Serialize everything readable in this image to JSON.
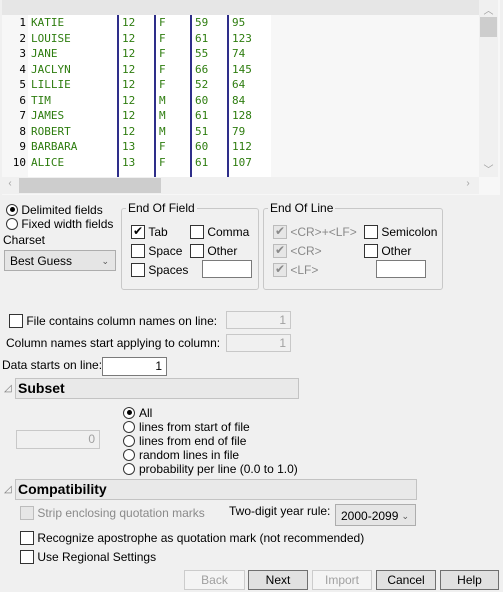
{
  "preview": {
    "row_numbers": [
      "1",
      "2",
      "3",
      "4",
      "5",
      "6",
      "7",
      "8",
      "9",
      "10"
    ],
    "rows": [
      [
        "KATIE",
        "12",
        "F",
        "59",
        "95"
      ],
      [
        "LOUISE",
        "12",
        "F",
        "61",
        "123"
      ],
      [
        "JANE",
        "12",
        "F",
        "55",
        "74"
      ],
      [
        "JACLYN",
        "12",
        "F",
        "66",
        "145"
      ],
      [
        "LILLIE",
        "12",
        "F",
        "52",
        "64"
      ],
      [
        "TIM",
        "12",
        "M",
        "60",
        "84"
      ],
      [
        "JAMES",
        "12",
        "M",
        "61",
        "128"
      ],
      [
        "ROBERT",
        "12",
        "M",
        "51",
        "79"
      ],
      [
        "BARBARA",
        "13",
        "F",
        "60",
        "112"
      ],
      [
        "ALICE",
        "13",
        "F",
        "61",
        "107"
      ]
    ],
    "text_color": "#2e7d0f",
    "separator_color": "#2e2e8a"
  },
  "field_type": {
    "delimited_label": "Delimited fields",
    "fixed_label": "Fixed width fields",
    "selected": "delimited"
  },
  "charset": {
    "label": "Charset",
    "value": "Best Guess"
  },
  "end_of_field": {
    "title": "End Of Field",
    "tab": {
      "label": "Tab",
      "checked": true
    },
    "comma": {
      "label": "Comma",
      "checked": false
    },
    "space": {
      "label": "Space",
      "checked": false
    },
    "other": {
      "label": "Other",
      "checked": false
    },
    "spaces": {
      "label": "Spaces",
      "checked": false
    },
    "other_value": ""
  },
  "end_of_line": {
    "title": "End Of Line",
    "crlf": {
      "label": "<CR>+<LF>",
      "checked": true
    },
    "cr": {
      "label": "<CR>",
      "checked": true
    },
    "lf": {
      "label": "<LF>",
      "checked": true
    },
    "semicolon": {
      "label": "Semicolon",
      "checked": false
    },
    "other": {
      "label": "Other",
      "checked": false
    },
    "other_value": ""
  },
  "headers": {
    "column_names_label": "File contains column names on line:",
    "column_names_line": "1",
    "apply_label": "Column names start applying to column:",
    "apply_value": "1",
    "data_starts_label": "Data starts on line:",
    "data_starts_value": "1"
  },
  "subset": {
    "title": "Subset",
    "count_value": "0",
    "options": [
      "All",
      "lines from start of file",
      "lines from end of file",
      "random lines in file",
      "probability per line (0.0 to 1.0)"
    ],
    "selected_index": 0
  },
  "compatibility": {
    "title": "Compatibility",
    "strip_quotes_label": "Strip enclosing quotation marks",
    "year_rule_label": "Two-digit year rule:",
    "year_rule_value": "2000-2099",
    "apostrophe_label": "Recognize apostrophe as quotation mark (not recommended)",
    "regional_label": "Use Regional Settings"
  },
  "buttons": {
    "back": "Back",
    "next": "Next",
    "import": "Import",
    "cancel": "Cancel",
    "help": "Help"
  }
}
